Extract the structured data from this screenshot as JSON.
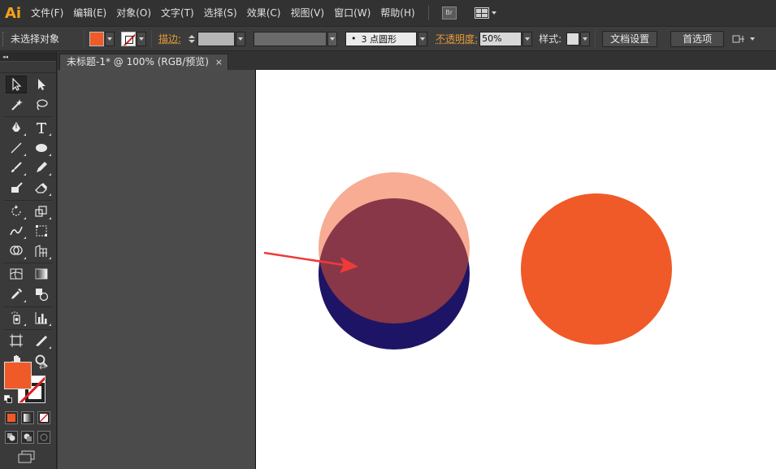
{
  "app": {
    "logo": "Ai"
  },
  "menu": [
    "文件(F)",
    "编辑(E)",
    "对象(O)",
    "文字(T)",
    "选择(S)",
    "效果(C)",
    "视图(V)",
    "窗口(W)",
    "帮助(H)"
  ],
  "menubar_extras": {
    "bridge_label": "Br"
  },
  "control_bar": {
    "selection_label": "未选择对象",
    "stroke_label": "描边:",
    "profile_dot": "•",
    "profile_label": "3 点圆形",
    "opacity_label": "不透明度:",
    "opacity_value": "50%",
    "style_label": "样式:",
    "doc_setup_button": "文档设置",
    "preferences_button": "首选项"
  },
  "toolbar": {
    "collapse_glyph": "◂◂"
  },
  "document": {
    "tab_title": "未标题-1* @ 100% (RGB/预览)",
    "close_glyph": "×"
  },
  "colors": {
    "fill": "#f05a28",
    "accent_orange_label": "#e89b3a",
    "circle_navy": "#1e1466",
    "circle_overlay": "#f05a28",
    "circle_overlay_opacity": 0.5,
    "circle_orange": "#f05a28",
    "arrow": "#f03a3a"
  }
}
